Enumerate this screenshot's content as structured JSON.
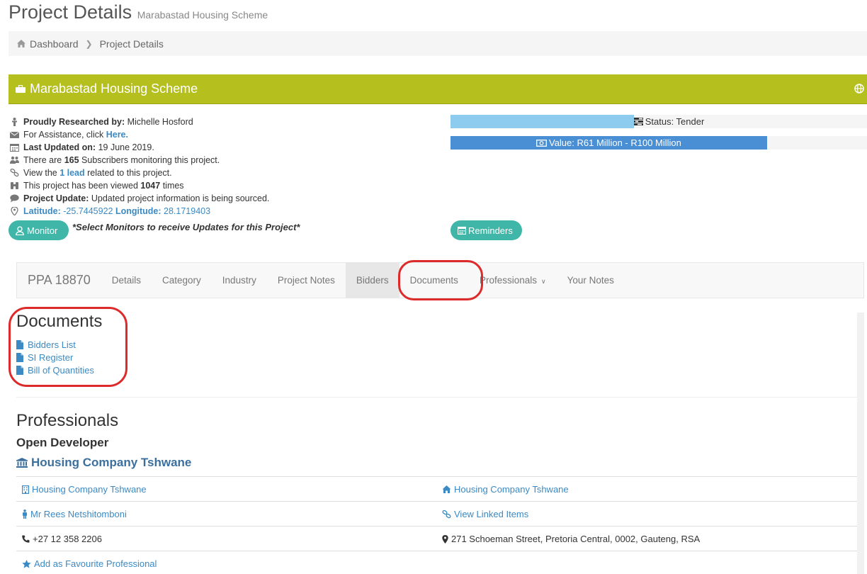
{
  "page": {
    "title": "Project Details",
    "subtitle": "Marabastad Housing Scheme"
  },
  "breadcrumb": {
    "home": "Dashboard",
    "current": "Project Details"
  },
  "banner": {
    "title": "Marabastad Housing Scheme",
    "color": "#b5bf1d"
  },
  "info": {
    "researched_label": "Proudly Researched by:",
    "researched_value": "Michelle Hosford",
    "assistance_text": "For Assistance, click",
    "assistance_link": "Here.",
    "updated_label": "Last Updated on:",
    "updated_value": "19 June 2019.",
    "subscribers_pre": "There are",
    "subscribers_count": "165",
    "subscribers_post": "Subscribers monitoring this project.",
    "lead_pre": "View the",
    "lead_link": "1 lead",
    "lead_post": "related to this project.",
    "viewed_pre": "This project has been viewed",
    "viewed_count": "1047",
    "viewed_post": "times",
    "update_label": "Project Update:",
    "update_value": "Updated project information is being sourced.",
    "lat_label": "Latitude:",
    "lat_value": "-25.7445922",
    "lon_label": "Longitude:",
    "lon_value": "28.1719403"
  },
  "status": {
    "label": "Status: Tender",
    "fill_fraction": 0.44,
    "color": "#8dcbef"
  },
  "value": {
    "label": "Value: R61 Million - R100 Million",
    "fill_fraction": 0.76,
    "color": "#4a8fd3"
  },
  "monitor": {
    "button": "Monitor",
    "note": "*Select Monitors to receive Updates for this Project*"
  },
  "reminders": {
    "button": "Reminders"
  },
  "tabs": {
    "brand": "PPA 18870",
    "items": [
      "Details",
      "Category",
      "Industry",
      "Project Notes",
      "Bidders",
      "Documents",
      "Professionals",
      "Your Notes"
    ]
  },
  "documents": {
    "title": "Documents",
    "items": [
      "Bidders List",
      "SI Register",
      "Bill of Quantities"
    ]
  },
  "professionals": {
    "title": "Professionals",
    "role": "Open Developer",
    "company": "Housing Company Tshwane",
    "rows": [
      [
        "Housing Company Tshwane",
        "Housing Company Tshwane"
      ],
      [
        "Mr Rees Netshitomboni",
        "View Linked Items"
      ],
      [
        "+27 12 358 2206",
        "271 Schoeman Street, Pretoria Central, 0002, Gauteng, RSA"
      ],
      [
        "Add as Favourite Professional",
        ""
      ]
    ]
  },
  "colors": {
    "accent_teal": "#3fb6a7",
    "link_blue": "#3b8ac4",
    "highlight_red": "#dd2a2a"
  }
}
